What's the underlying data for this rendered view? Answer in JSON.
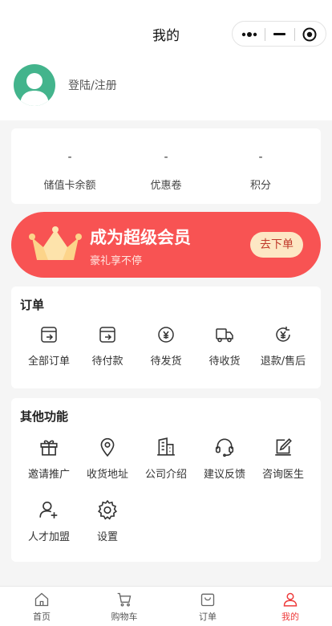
{
  "header": {
    "title": "我的"
  },
  "profile": {
    "login_text": "登陆/注册"
  },
  "assets": [
    {
      "value": "-",
      "label": "储值卡余额"
    },
    {
      "value": "-",
      "label": "优惠卷"
    },
    {
      "value": "-",
      "label": "积分"
    }
  ],
  "vip": {
    "title": "成为超级会员",
    "subtitle": "豪礼享不停",
    "button": "去下单",
    "bg_color": "#f85353",
    "button_bg": "#fde7c4"
  },
  "orders": {
    "title": "订单",
    "items": [
      {
        "label": "全部订单",
        "icon": "all-orders-icon"
      },
      {
        "label": "待付款",
        "icon": "pending-payment-icon"
      },
      {
        "label": "待发货",
        "icon": "pending-shipment-icon"
      },
      {
        "label": "待收货",
        "icon": "truck-icon"
      },
      {
        "label": "退款/售后",
        "icon": "refund-icon"
      }
    ]
  },
  "functions": {
    "title": "其他功能",
    "items": [
      {
        "label": "邀请推广",
        "icon": "gift-icon"
      },
      {
        "label": "收货地址",
        "icon": "location-pin-icon"
      },
      {
        "label": "公司介绍",
        "icon": "building-icon"
      },
      {
        "label": "建议反馈",
        "icon": "headset-icon"
      },
      {
        "label": "咨询医生",
        "icon": "edit-note-icon"
      },
      {
        "label": "人才加盟",
        "icon": "add-user-icon"
      },
      {
        "label": "设置",
        "icon": "gear-icon"
      }
    ]
  },
  "tabbar": {
    "items": [
      {
        "label": "首页",
        "icon": "home-icon"
      },
      {
        "label": "购物车",
        "icon": "cart-icon"
      },
      {
        "label": "订单",
        "icon": "order-bag-icon"
      },
      {
        "label": "我的",
        "icon": "user-icon",
        "active": true
      }
    ],
    "active_color": "#ee3b3b"
  }
}
